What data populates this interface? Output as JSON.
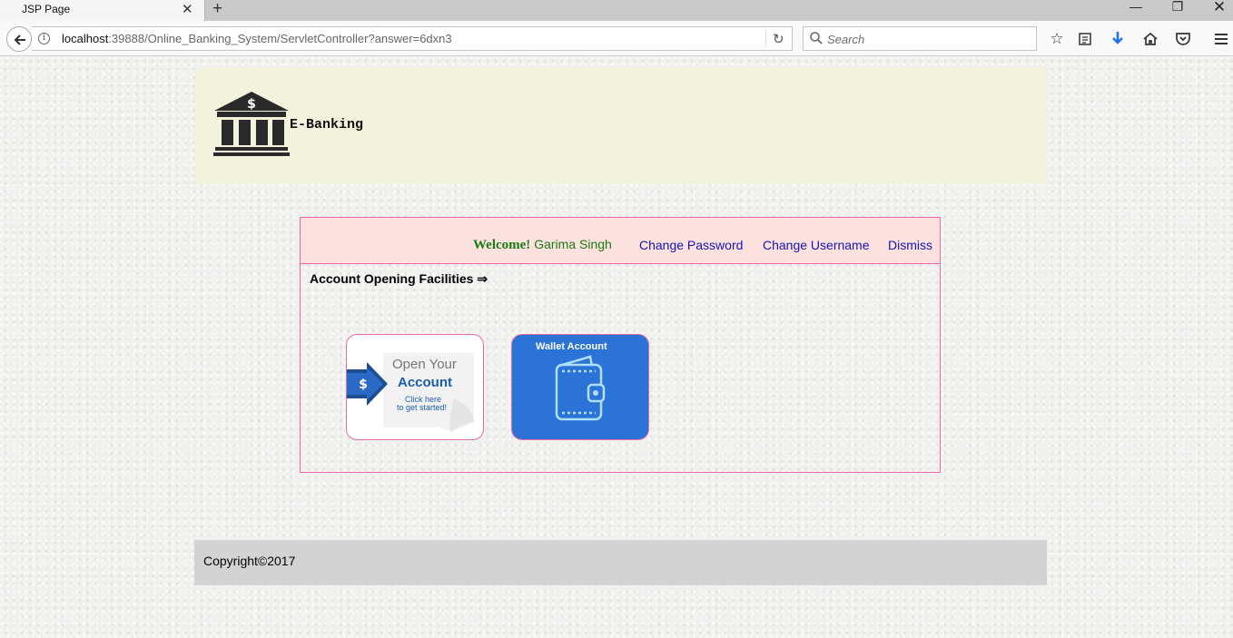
{
  "browser": {
    "tab_title": "JSP Page",
    "url_host": "localhost",
    "url_rest": ":39888/Online_Banking_System/ServletController?answer=6dxn3",
    "search_placeholder": "Search",
    "icons": [
      "back-arrow-icon",
      "info-icon",
      "reload-icon",
      "search-icon",
      "bookmark-star-icon",
      "reading-list-icon",
      "download-icon",
      "home-icon",
      "pocket-icon",
      "menu-icon"
    ]
  },
  "header": {
    "brand": "E-Banking",
    "logo_symbol": "$"
  },
  "panel": {
    "welcome_label": "Welcome!",
    "user_name": "Garima Singh",
    "links": {
      "change_password": "Change Password",
      "change_username": "Change Username",
      "dismiss": "Dismiss"
    },
    "facilities_heading": "Account Opening Facilities ⇒",
    "cards": {
      "open_account": {
        "line1": "Open Your",
        "line2": "Account",
        "line3": "Click here",
        "line4": "to get started!",
        "symbol": "$"
      },
      "wallet": {
        "label": "Wallet Account"
      }
    }
  },
  "footer": {
    "copyright": "Copyright©2017"
  },
  "colors": {
    "header_bg": "#f3f2dc",
    "panel_border": "#e86aa5",
    "panel_top_bg": "#fde1df",
    "welcome_green": "#1a7a14",
    "link_blue": "#1515b8",
    "wallet_blue": "#2b73d6",
    "footer_bg": "#d3d3d3"
  }
}
